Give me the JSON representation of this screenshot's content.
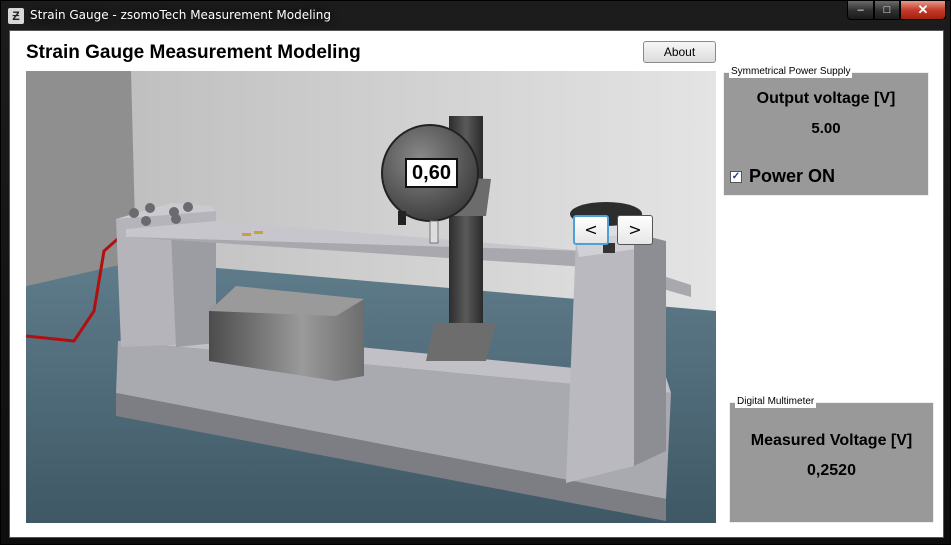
{
  "window": {
    "title": "Strain Gauge - zsomoTech Measurement Modeling",
    "app_icon": "zsomotech-logo-icon",
    "controls": {
      "minimize": "–",
      "maximize": "□",
      "close": "✕"
    }
  },
  "header": {
    "title": "Strain Gauge Measurement Modeling",
    "about_label": "About"
  },
  "scene": {
    "dial_reading": "0,60",
    "prev_label": "<",
    "next_label": ">"
  },
  "power_supply": {
    "caption": "Symmetrical Power Supply",
    "output_label": "Output voltage [V]",
    "output_value": "5.00",
    "power_checked": true,
    "power_check_mark": "✓",
    "power_label": "Power ON"
  },
  "multimeter": {
    "caption": "Digital Multimeter",
    "measured_label": "Measured Voltage [V]",
    "measured_value": "0,2520"
  },
  "colors": {
    "panel": "#999999",
    "floor": "#4f6a79",
    "wall": "#cfcfcf",
    "wire": "#b01010"
  }
}
